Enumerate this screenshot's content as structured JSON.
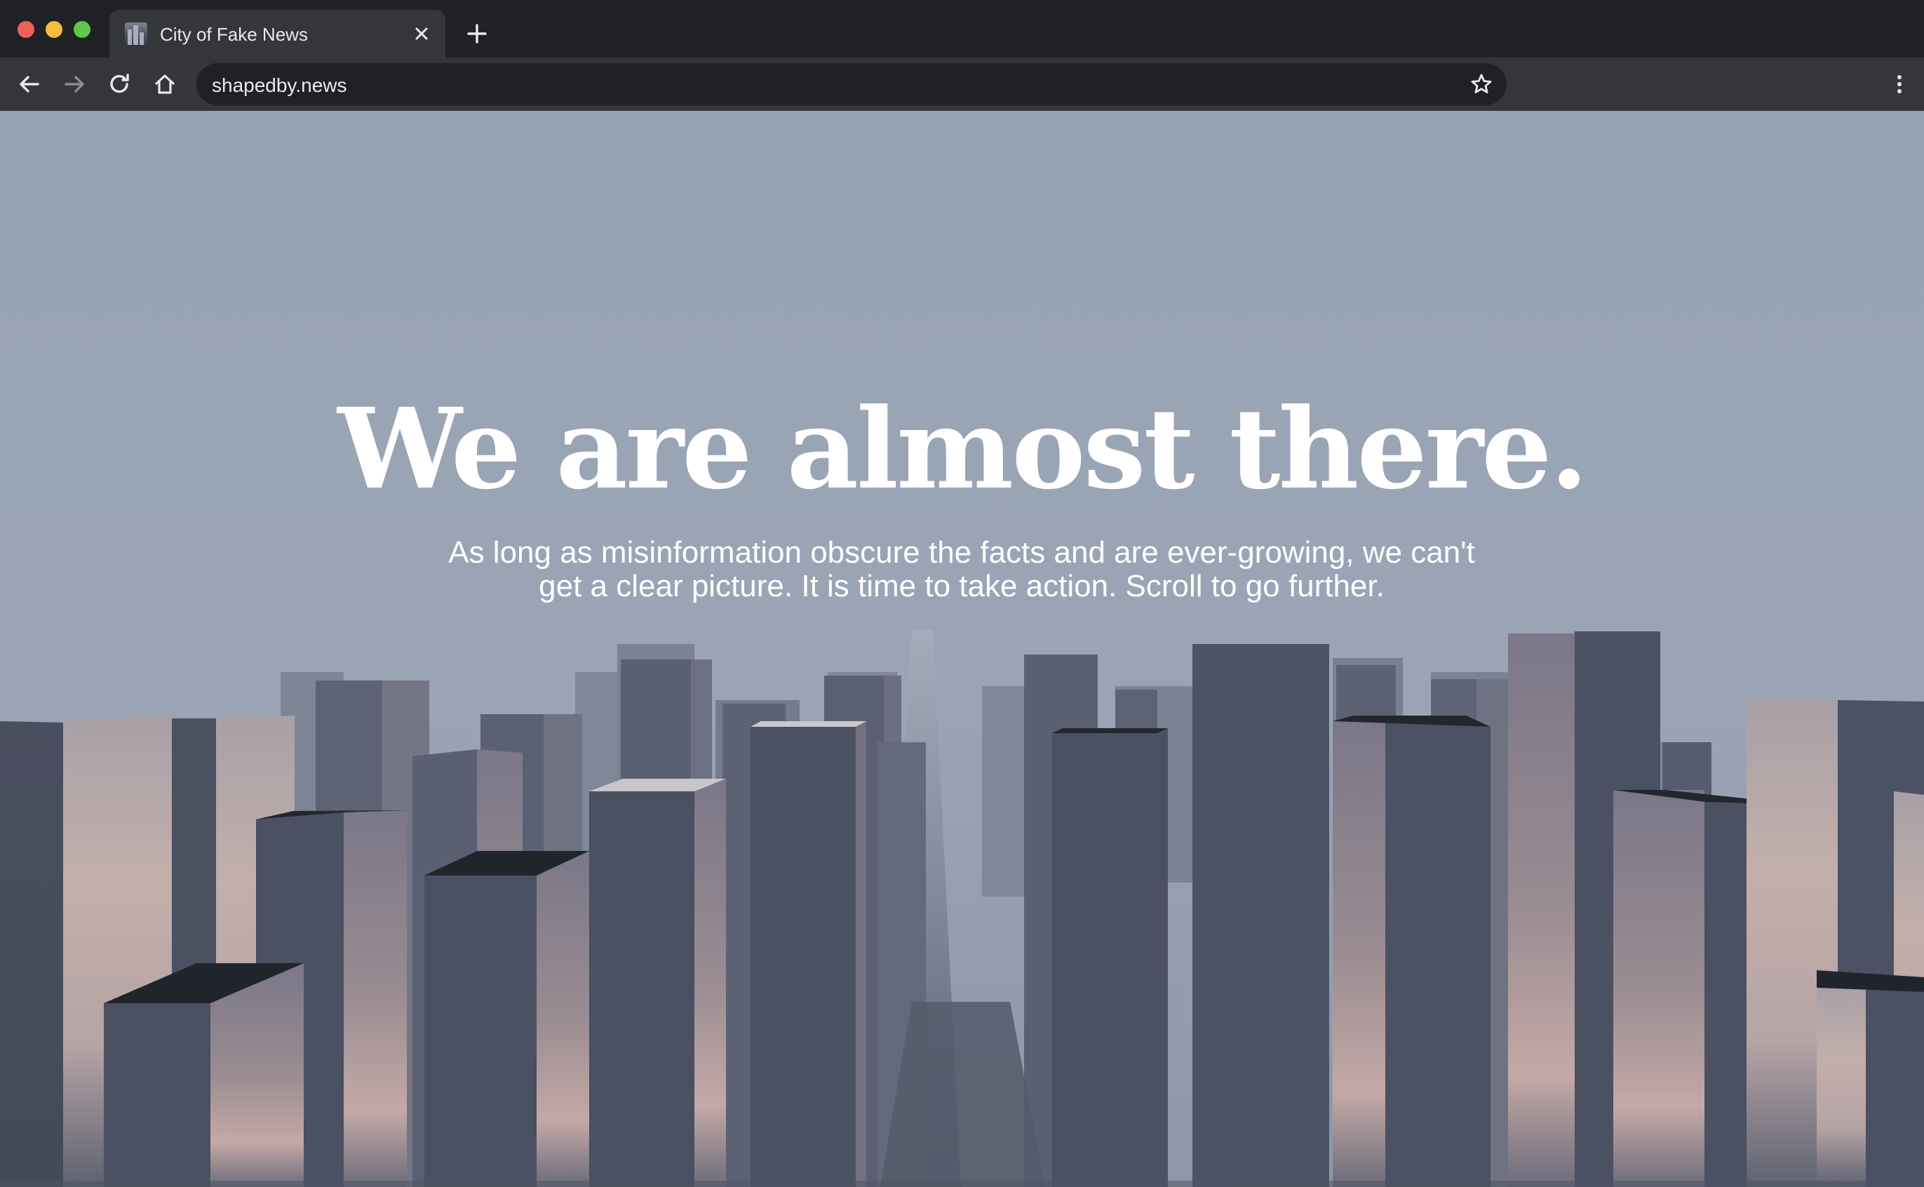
{
  "browser": {
    "tab": {
      "title": "City of Fake News",
      "favicon": "city-favicon-icon",
      "close_icon": "close-icon"
    },
    "new_tab_icon": "plus-icon",
    "toolbar": {
      "back_icon": "arrow-left-icon",
      "forward_icon": "arrow-right-icon",
      "reload_icon": "reload-icon",
      "home_icon": "home-icon",
      "url": "shapedby.news",
      "bookmark_icon": "star-icon",
      "menu_icon": "more-vertical-icon"
    },
    "colors": {
      "tabbar": "#202124",
      "toolbar": "#35363a",
      "omnibox": "#202124",
      "close": "#ee5f57",
      "minimize": "#f4be3c",
      "maximize": "#5fc84a"
    }
  },
  "page": {
    "headline": "We are almost there.",
    "subtitle": "As long as misinformation obscure the facts and are ever-growing, we can't get a clear picture. It is time to take action. Scroll to go further.",
    "background_color": "#98a3b3",
    "scene": "3d-city-of-skyscrapers"
  }
}
